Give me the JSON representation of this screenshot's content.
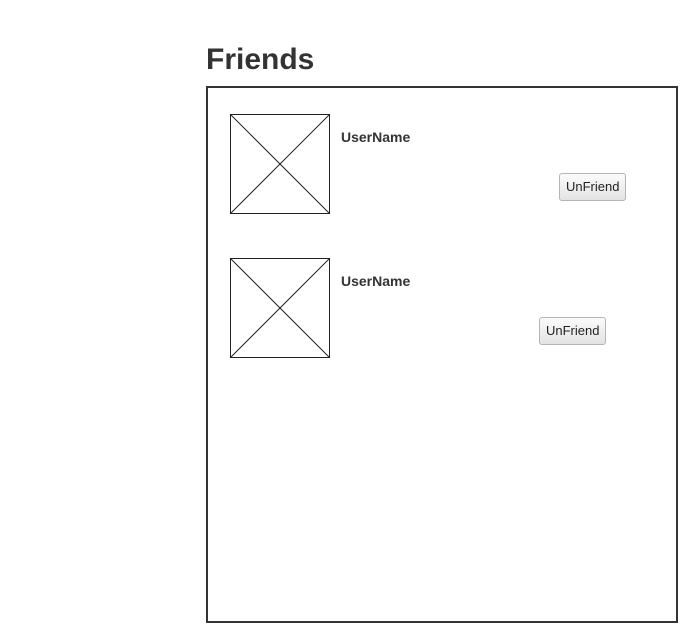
{
  "page": {
    "title": "Friends"
  },
  "friends": [
    {
      "username": "UserName",
      "unfriend_label": "UnFriend",
      "avatar_icon": "image-placeholder-icon"
    },
    {
      "username": "UserName",
      "unfriend_label": "UnFriend",
      "avatar_icon": "image-placeholder-icon"
    }
  ]
}
